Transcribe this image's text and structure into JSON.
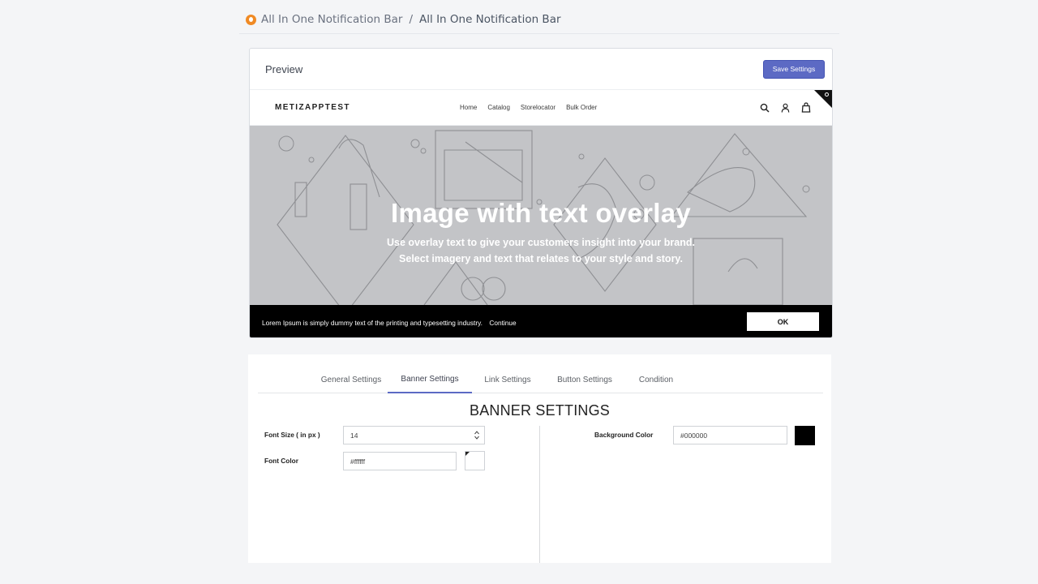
{
  "breadcrumb": {
    "app_icon": "app-logo-icon",
    "parent": "All In One Notification Bar",
    "separator": "/",
    "current": "All In One Notification Bar"
  },
  "preview": {
    "title": "Preview",
    "save_label": "Save Settings",
    "store": {
      "logo": "METIZAPPTEST",
      "menu": [
        "Home",
        "Catalog",
        "Storelocator",
        "Bulk Order"
      ],
      "icons": [
        "search-icon",
        "account-icon",
        "cart-icon"
      ]
    },
    "hero": {
      "title": "Image with text overlay",
      "subtitle_line1": "Use overlay text to give your customers insight into your brand.",
      "subtitle_line2": "Select imagery and text that relates to your style and story."
    },
    "notification_bar": {
      "text": "Lorem Ipsum is simply dummy text of the printing and typesetting industry.",
      "link": "Continue",
      "button": "OK"
    }
  },
  "settings": {
    "tabs": [
      "General Settings",
      "Banner Settings",
      "Link Settings",
      "Button Settings",
      "Condition"
    ],
    "active_tab": "Banner Settings",
    "section_title": "BANNER SETTINGS",
    "font_size": {
      "label": "Font Size ( in px )",
      "value": "14"
    },
    "font_color": {
      "label": "Font Color",
      "value": "#ffffff"
    },
    "background_color": {
      "label": "Background Color",
      "value": "#000000"
    }
  },
  "colors": {
    "accent": "#5c6ac4",
    "notification_bg": "#000000",
    "hero_bg": "#c3c4c7",
    "breadcrumb_icon": "#f08a24"
  }
}
